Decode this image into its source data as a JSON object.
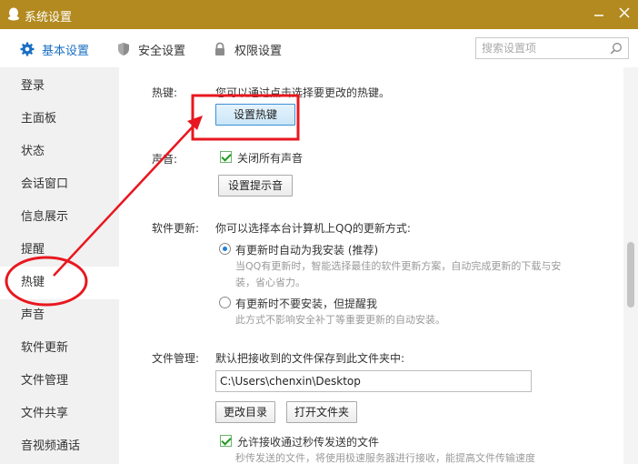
{
  "window": {
    "title": "系统设置",
    "minimize_icon": "minimize-icon",
    "close_icon": "close-icon"
  },
  "tabs": [
    {
      "label": "基本设置",
      "icon": "gear-icon",
      "active": true
    },
    {
      "label": "安全设置",
      "icon": "shield-icon",
      "active": false
    },
    {
      "label": "权限设置",
      "icon": "lock-icon",
      "active": false
    }
  ],
  "search": {
    "placeholder": "搜索设置项"
  },
  "sidebar": {
    "items": [
      {
        "label": "登录"
      },
      {
        "label": "主面板"
      },
      {
        "label": "状态"
      },
      {
        "label": "会话窗口"
      },
      {
        "label": "信息展示"
      },
      {
        "label": "提醒"
      },
      {
        "label": "热键",
        "active": true
      },
      {
        "label": "声音"
      },
      {
        "label": "软件更新"
      },
      {
        "label": "文件管理"
      },
      {
        "label": "文件共享"
      },
      {
        "label": "音视频通话"
      }
    ]
  },
  "hotkey": {
    "label": "热键:",
    "desc": "您可以通过点击选择要更改的热键。",
    "button": "设置热键"
  },
  "sound": {
    "label": "声音:",
    "mute_all": "关闭所有声音",
    "mute_all_checked": true,
    "button": "设置提示音"
  },
  "update": {
    "label": "软件更新:",
    "desc": "你可以选择本台计算机上QQ的更新方式:",
    "option1": "有更新时自动为我安装 (推荐)",
    "option1_desc": "当QQ有更新时，智能选择最佳的软件更新方案，自动完成更新的下载与安装，省心省力。",
    "option2": "有更新时不要安装，但提醒我",
    "option2_desc": "此方式不影响安全补丁等重要更新的自动安装。",
    "selected": 1
  },
  "file": {
    "label": "文件管理:",
    "desc": "默认把接收到的文件保存到此文件夹中:",
    "path": "C:\\Users\\chenxin\\Desktop",
    "change_button": "更改目录",
    "open_button": "打开文件夹",
    "allow_second_send": "允许接收通过秒传发送的文件",
    "allow_second_send_checked": true,
    "allow_second_send_desc": "秒传发送的文件，将使用极速服务器进行接收，能提高文件传输速度"
  },
  "colors": {
    "titlebar": "#b38a1f",
    "accent": "#1a6fc2",
    "annotation": "#e8171f"
  }
}
